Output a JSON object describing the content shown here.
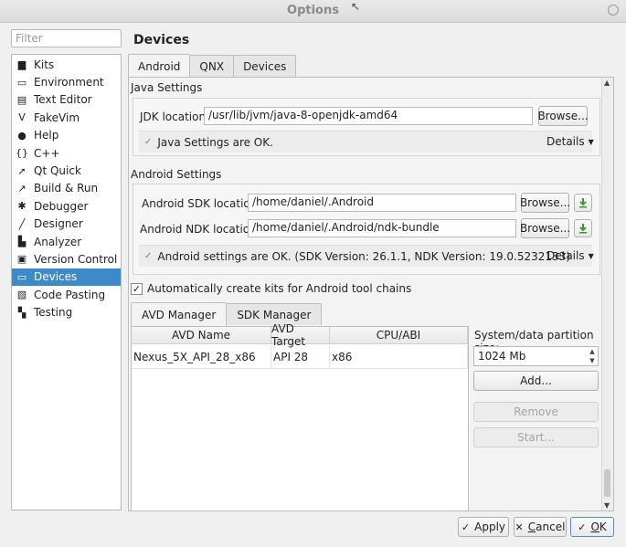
{
  "window": {
    "title": "Options"
  },
  "filter": {
    "placeholder": "Filter"
  },
  "categories": [
    {
      "label": "Kits",
      "icon": "kits-icon",
      "glyph": "▆"
    },
    {
      "label": "Environment",
      "icon": "monitor-icon",
      "glyph": "▭"
    },
    {
      "label": "Text Editor",
      "icon": "text-editor-icon",
      "glyph": "▤"
    },
    {
      "label": "FakeVim",
      "icon": "fakevim-icon",
      "glyph": "V"
    },
    {
      "label": "Help",
      "icon": "help-icon",
      "glyph": "●"
    },
    {
      "label": "C++",
      "icon": "cpp-braces-icon",
      "glyph": "{}"
    },
    {
      "label": "Qt Quick",
      "icon": "qt-quick-icon",
      "glyph": "➚"
    },
    {
      "label": "Build & Run",
      "icon": "build-run-icon",
      "glyph": "↗"
    },
    {
      "label": "Debugger",
      "icon": "debugger-bug-icon",
      "glyph": "✱"
    },
    {
      "label": "Designer",
      "icon": "designer-pen-icon",
      "glyph": "╱"
    },
    {
      "label": "Analyzer",
      "icon": "analyzer-icon",
      "glyph": "▙"
    },
    {
      "label": "Version Control",
      "icon": "version-control-icon",
      "glyph": "▣"
    },
    {
      "label": "Devices",
      "icon": "devices-icon",
      "glyph": "▭"
    },
    {
      "label": "Code Pasting",
      "icon": "code-pasting-icon",
      "glyph": "▧"
    },
    {
      "label": "Testing",
      "icon": "testing-icon",
      "glyph": "▚"
    }
  ],
  "selected_category": "Devices",
  "page": {
    "title": "Devices",
    "tabs": [
      "Android",
      "QNX",
      "Devices"
    ],
    "selected_tab": "Android"
  },
  "java": {
    "section": "Java Settings",
    "jdk_label": "JDK location:",
    "jdk_value": "/usr/lib/jvm/java-8-openjdk-amd64",
    "browse": "Browse...",
    "status": "Java Settings are OK.",
    "details": "Details"
  },
  "android": {
    "section": "Android Settings",
    "sdk_label": "Android SDK location:",
    "sdk_value": "/home/daniel/.Android",
    "ndk_label": "Android NDK location:",
    "ndk_value": "/home/daniel/.Android/ndk-bundle",
    "browse": "Browse...",
    "status": "Android settings are OK. (SDK Version: 26.1.1, NDK Version: 19.0.5232133)",
    "details": "Details"
  },
  "auto_kits": {
    "label": "Automatically create kits for Android tool chains",
    "checked": true,
    "mark": "✓"
  },
  "avd": {
    "tabs": [
      "AVD Manager",
      "SDK Manager"
    ],
    "selected_tab": "AVD Manager",
    "columns": [
      "AVD Name",
      "AVD Target",
      "CPU/ABI"
    ],
    "rows": [
      {
        "name": "Nexus_5X_API_28_x86",
        "target": "API 28",
        "cpu": "x86"
      }
    ],
    "partition_label": "System/data partition size:",
    "partition_value": "1024 Mb",
    "add": "Add...",
    "remove": "Remove",
    "start": "Start..."
  },
  "buttons": {
    "apply": "Apply",
    "cancel_pre": "",
    "cancel_ul": "C",
    "cancel_post": "ancel",
    "ok_ul": "O",
    "ok_post": "K"
  },
  "colors": {
    "selection": "#3c8ac9",
    "ok_check": "#5aa02c",
    "download": "#3a9a2a"
  }
}
